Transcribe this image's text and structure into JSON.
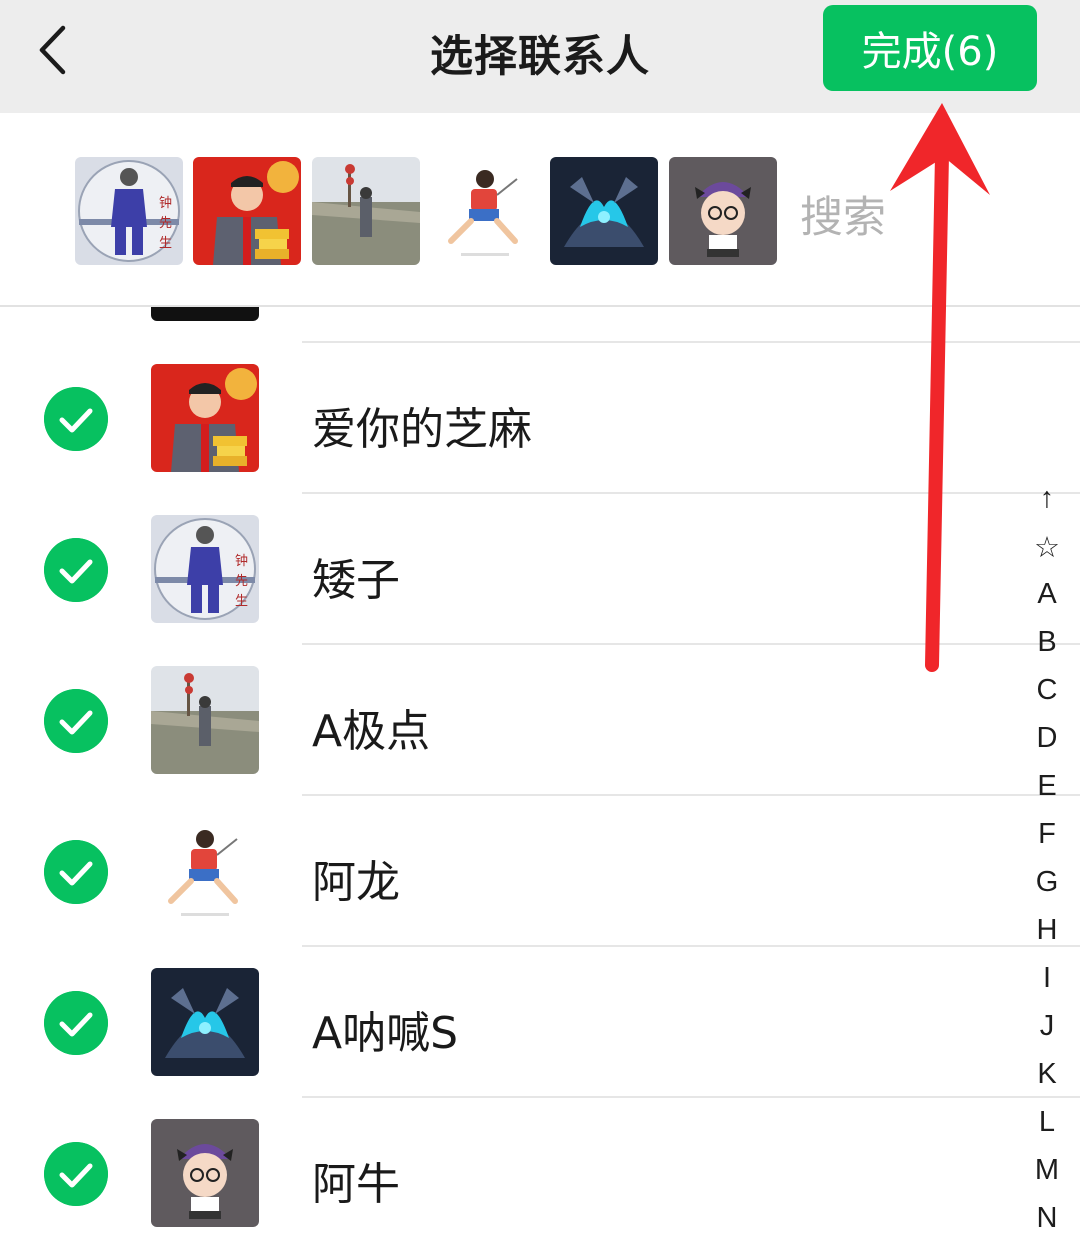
{
  "header": {
    "title": "选择联系人",
    "done_label": "完成(6)"
  },
  "search": {
    "placeholder": "搜索"
  },
  "selected": [
    {
      "name": "矮子",
      "avatar": "dancer-photo"
    },
    {
      "name": "爱你的芝麻",
      "avatar": "man-red-background"
    },
    {
      "name": "A极点",
      "avatar": "great-wall-photo"
    },
    {
      "name": "阿龙",
      "avatar": "badminton-player"
    },
    {
      "name": "A呐喊S",
      "avatar": "game-hero-blue"
    },
    {
      "name": "阿牛",
      "avatar": "cartoon-boy"
    }
  ],
  "contacts": [
    {
      "name": "爱你的芝麻",
      "checked": true,
      "avatar": "man-red-background"
    },
    {
      "name": "矮子",
      "checked": true,
      "avatar": "dancer-photo"
    },
    {
      "name": "A极点",
      "checked": true,
      "avatar": "great-wall-photo"
    },
    {
      "name": "阿龙",
      "checked": true,
      "avatar": "badminton-player"
    },
    {
      "name": "A呐喊S",
      "checked": true,
      "avatar": "game-hero-blue"
    },
    {
      "name": "阿牛",
      "checked": true,
      "avatar": "cartoon-boy"
    }
  ],
  "index": [
    "↑",
    "☆",
    "A",
    "B",
    "C",
    "D",
    "E",
    "F",
    "G",
    "H",
    "I",
    "J",
    "K",
    "L",
    "M",
    "N"
  ],
  "colors": {
    "accent": "#07c160",
    "header_bg": "#ededed",
    "annotation_arrow": "#f0262a"
  }
}
